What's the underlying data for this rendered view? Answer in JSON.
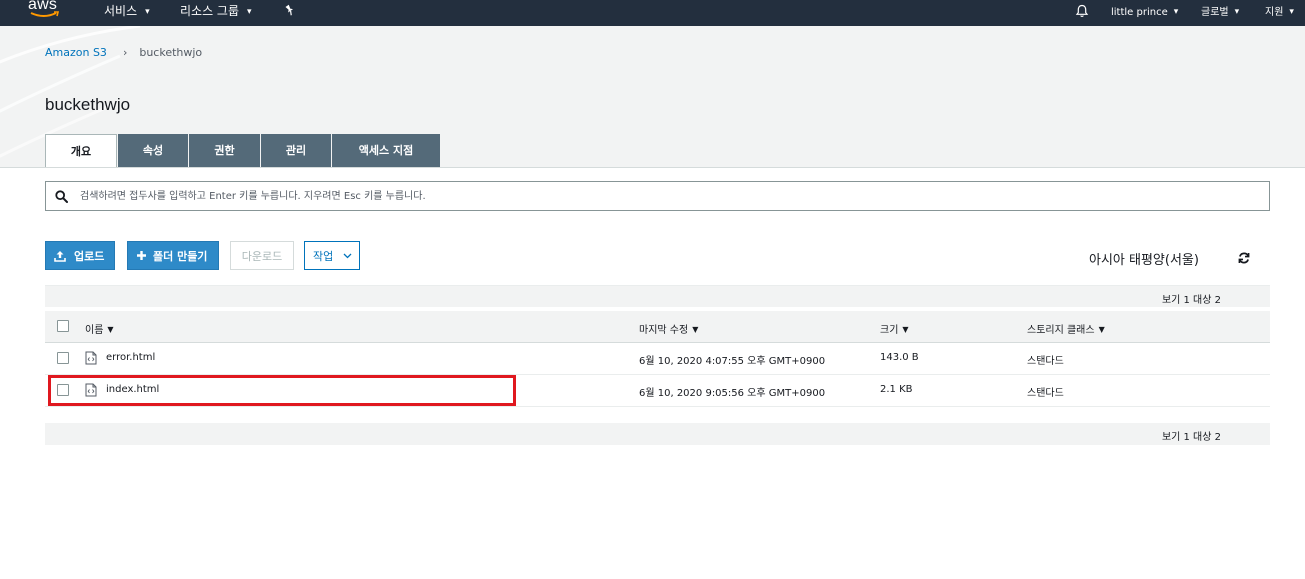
{
  "topnav": {
    "logo_text": "aws",
    "services_label": "서비스",
    "resource_groups_label": "리소스 그룹",
    "pin_icon": "pin-icon",
    "bell_icon": "bell-icon",
    "user_label": "little prince",
    "global_label": "글로벌",
    "support_label": "지원",
    "colors": {
      "background": "#232f3e",
      "text": "#ffffff",
      "smile": "#ff9900"
    }
  },
  "breadcrumb": {
    "root": "Amazon S3",
    "separator": "›",
    "current": "buckethwjo"
  },
  "page": {
    "title": "buckethwjo"
  },
  "tabs": [
    {
      "label": "개요",
      "active": true
    },
    {
      "label": "속성",
      "active": false
    },
    {
      "label": "권한",
      "active": false
    },
    {
      "label": "관리",
      "active": false
    },
    {
      "label": "액세스 지점",
      "active": false
    }
  ],
  "search": {
    "placeholder": "검색하려면 접두사를 입력하고 Enter 키를 누릅니다. 지우려면 Esc 키를 누릅니다.",
    "icon": "search-icon"
  },
  "actions": {
    "upload_label": "업로드",
    "create_folder_label": "폴더 만들기",
    "download_label": "다운로드",
    "actions_label": "작업"
  },
  "region": {
    "label": "아시아 태평양(서울)",
    "refresh_icon": "refresh-icon"
  },
  "table": {
    "view_count_top": "보기 1 대상 2",
    "view_count_bottom": "보기 1 대상 2",
    "columns": [
      "이름",
      "마지막 수정",
      "크기",
      "스토리지 클래스"
    ],
    "rows": [
      {
        "name": "error.html",
        "modified": "6월 10, 2020 4:07:55 오후 GMT+0900",
        "size": "143.0 B",
        "storage_class": "스탠다드"
      },
      {
        "name": "index.html",
        "modified": "6월 10, 2020 9:05:56 오후 GMT+0900",
        "size": "2.1 KB",
        "storage_class": "스탠다드"
      }
    ]
  },
  "colors": {
    "primary_button": "#2e8ac8",
    "link": "#0073bb",
    "tab_inactive": "#546a79",
    "highlight": "#e0181f"
  }
}
